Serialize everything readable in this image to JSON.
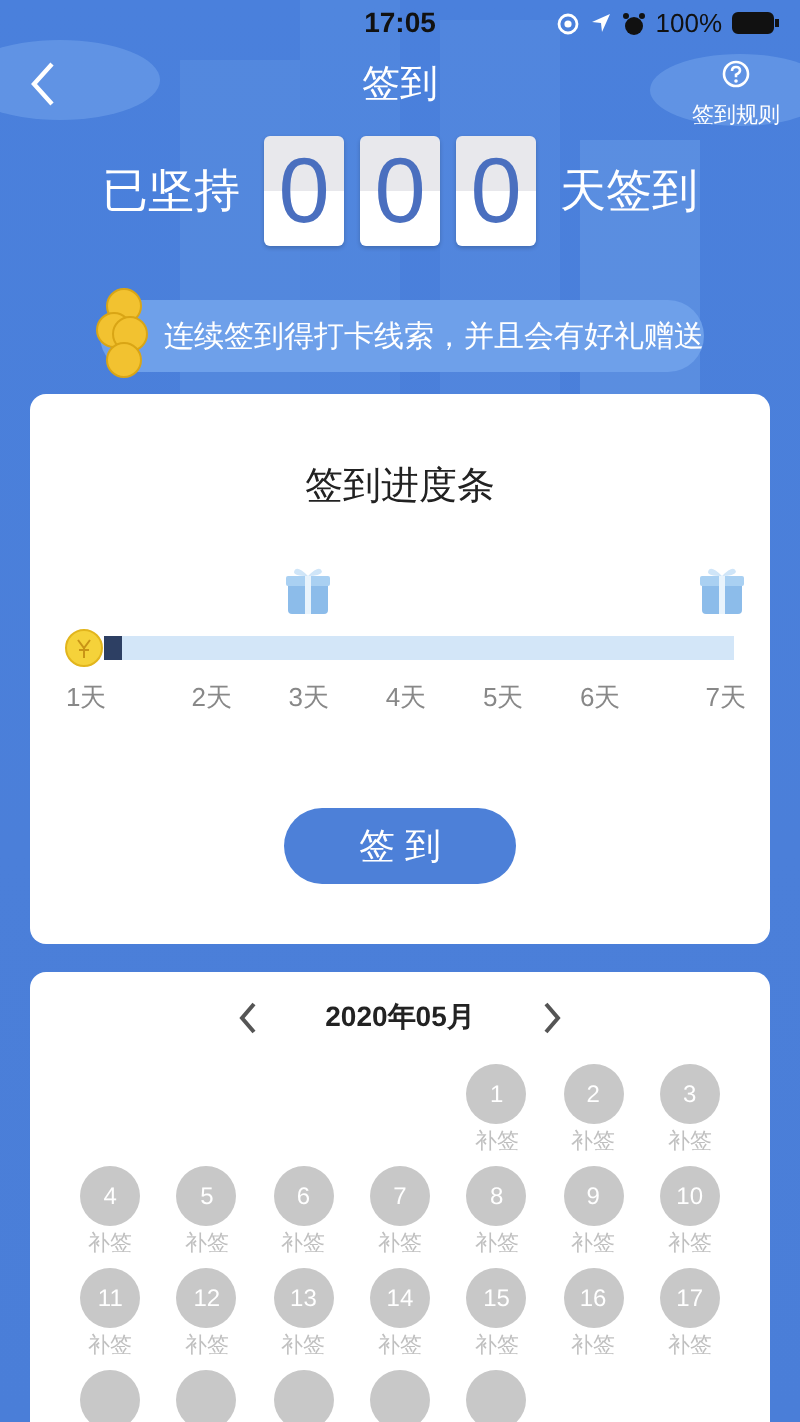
{
  "status_bar": {
    "time": "17:05",
    "battery": "100%"
  },
  "header": {
    "title": "签到",
    "rules_label": "签到规则"
  },
  "streak": {
    "prefix": "已坚持",
    "digits": [
      "0",
      "0",
      "0"
    ],
    "suffix": "天签到"
  },
  "banner": {
    "text": "连续签到得打卡线索，并且会有好礼赠送"
  },
  "progress": {
    "title": "签到进度条",
    "level": 0.03,
    "days": [
      {
        "label": "1天",
        "gift": false
      },
      {
        "label": "2天",
        "gift": false
      },
      {
        "label": "3天",
        "gift": true
      },
      {
        "label": "4天",
        "gift": false
      },
      {
        "label": "5天",
        "gift": false
      },
      {
        "label": "6天",
        "gift": false
      },
      {
        "label": "7天",
        "gift": true
      }
    ],
    "button": "签 到"
  },
  "calendar": {
    "month": "2020年05月",
    "days": [
      {
        "kind": "blank"
      },
      {
        "kind": "blank"
      },
      {
        "kind": "blank"
      },
      {
        "kind": "blank"
      },
      {
        "kind": "day",
        "number": "1",
        "note": "补签"
      },
      {
        "kind": "day",
        "number": "2",
        "note": "补签"
      },
      {
        "kind": "day",
        "number": "3",
        "note": "补签"
      },
      {
        "kind": "day",
        "number": "4",
        "note": "补签"
      },
      {
        "kind": "day",
        "number": "5",
        "note": "补签"
      },
      {
        "kind": "day",
        "number": "6",
        "note": "补签"
      },
      {
        "kind": "day",
        "number": "7",
        "note": "补签"
      },
      {
        "kind": "day",
        "number": "8",
        "note": "补签"
      },
      {
        "kind": "day",
        "number": "9",
        "note": "补签"
      },
      {
        "kind": "day",
        "number": "10",
        "note": "补签"
      },
      {
        "kind": "day",
        "number": "11",
        "note": "补签"
      },
      {
        "kind": "day",
        "number": "12",
        "note": "补签"
      },
      {
        "kind": "day",
        "number": "13",
        "note": "补签"
      },
      {
        "kind": "day",
        "number": "14",
        "note": "补签"
      },
      {
        "kind": "day",
        "number": "15",
        "note": "补签"
      },
      {
        "kind": "day",
        "number": "16",
        "note": "补签"
      },
      {
        "kind": "day",
        "number": "17",
        "note": "补签"
      },
      {
        "kind": "cut"
      },
      {
        "kind": "cut"
      },
      {
        "kind": "cut"
      },
      {
        "kind": "cut"
      },
      {
        "kind": "cut"
      }
    ]
  }
}
